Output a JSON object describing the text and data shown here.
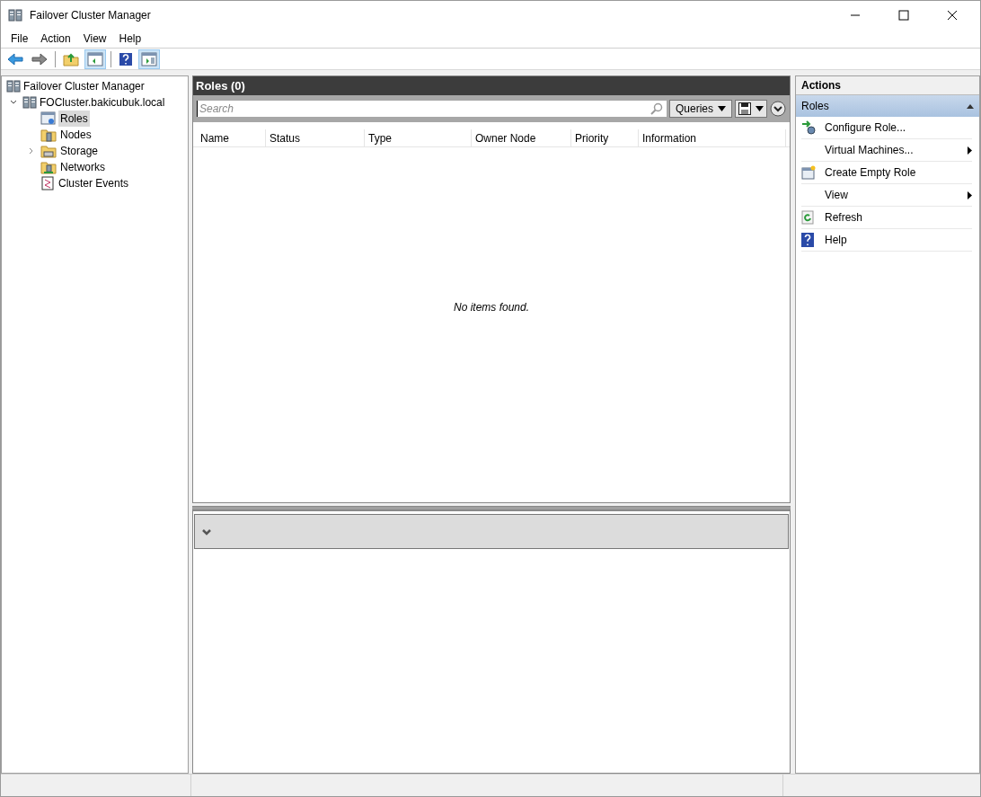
{
  "window": {
    "title": "Failover Cluster Manager"
  },
  "menu": [
    "File",
    "Action",
    "View",
    "Help"
  ],
  "toolbar": [
    {
      "kind": "back",
      "pressed": false
    },
    {
      "kind": "forward",
      "pressed": false
    },
    {
      "kind": "up",
      "pressed": false
    },
    {
      "kind": "tree",
      "pressed": true
    },
    {
      "kind": "help",
      "pressed": false
    },
    {
      "kind": "actionpane",
      "pressed": true
    }
  ],
  "tree": {
    "label": "Failover Cluster Manager",
    "children": [
      {
        "label": "FOCluster.bakicubuk.local",
        "expanded": true,
        "children": [
          {
            "label": "Roles",
            "kind": "roles",
            "selected": true,
            "collapsible": false
          },
          {
            "label": "Nodes",
            "kind": "nodes",
            "selected": false,
            "collapsible": false
          },
          {
            "label": "Storage",
            "kind": "storage",
            "selected": false,
            "collapsible": true
          },
          {
            "label": "Networks",
            "kind": "networks",
            "selected": false,
            "collapsible": false
          },
          {
            "label": "Cluster Events",
            "kind": "events",
            "selected": false,
            "collapsible": false
          }
        ]
      }
    ]
  },
  "center": {
    "title": "Roles (0)",
    "search": {
      "placeholder": "Search"
    },
    "queries_button": "Queries",
    "columns": [
      "Name",
      "Status",
      "Type",
      "Owner Node",
      "Priority",
      "Information"
    ],
    "empty_message": "No items found."
  },
  "actions": {
    "title": "Actions",
    "section": "Roles",
    "items": [
      {
        "label": "Configure Role...",
        "kind": "configure",
        "submenu": false
      },
      {
        "label": "Virtual Machines...",
        "kind": "plain",
        "submenu": true
      },
      {
        "label": "Create Empty Role",
        "kind": "emptyrole",
        "submenu": false
      },
      {
        "label": "View",
        "kind": "plain",
        "submenu": true
      },
      {
        "label": "Refresh",
        "kind": "refresh",
        "submenu": false
      },
      {
        "label": "Help",
        "kind": "help",
        "submenu": false
      }
    ]
  }
}
